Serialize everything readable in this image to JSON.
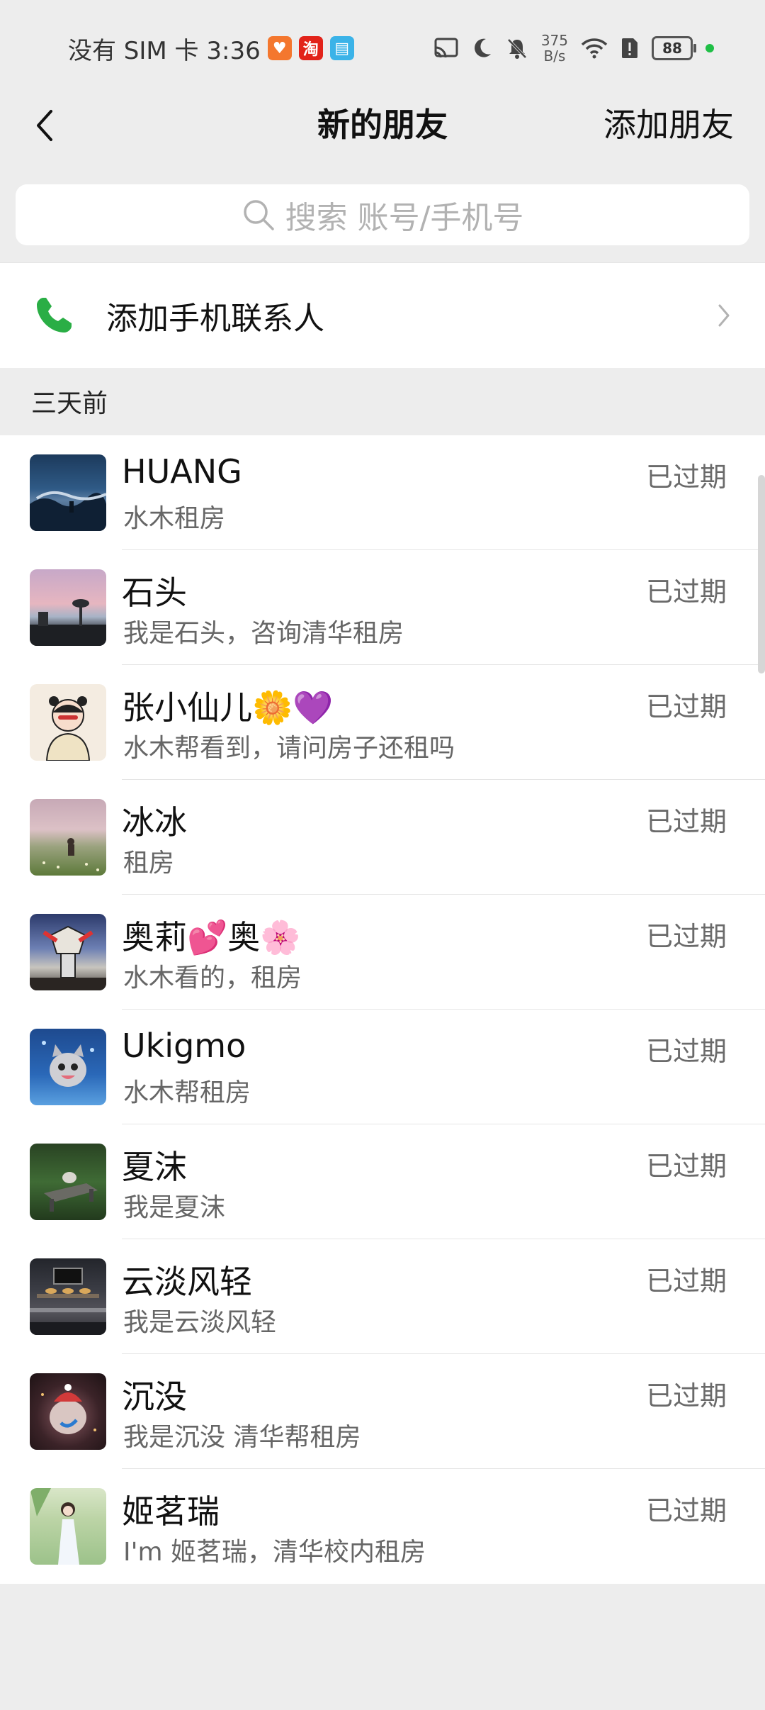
{
  "status_bar": {
    "carrier_time": "没有 SIM 卡 3:36",
    "app_icons": [
      {
        "name": "orange-app-icon",
        "glyph": "♥",
        "color": "#f4772e"
      },
      {
        "name": "taobao-app-icon",
        "glyph": "淘",
        "color": "#e2231a"
      },
      {
        "name": "reader-app-icon",
        "glyph": "▤",
        "color": "#3bb3e8"
      }
    ],
    "net_speed_value": "375",
    "net_speed_unit": "B/s",
    "battery": "88"
  },
  "nav": {
    "title": "新的朋友",
    "action": "添加朋友"
  },
  "search": {
    "placeholder": "搜索 账号/手机号"
  },
  "add_phone": {
    "label": "添加手机联系人"
  },
  "section": {
    "title": "三天前"
  },
  "friends": [
    {
      "name": "HUANG",
      "message": "水木租房",
      "status": "已过期"
    },
    {
      "name": "石头",
      "message": "我是石头，咨询清华租房",
      "status": "已过期"
    },
    {
      "name": "张小仙儿🌼💜",
      "message": "水木帮看到，请问房子还租吗",
      "status": "已过期"
    },
    {
      "name": "冰冰",
      "message": "租房",
      "status": "已过期"
    },
    {
      "name": "奥莉💕奥🌸",
      "message": "水木看的，租房",
      "status": "已过期"
    },
    {
      "name": "Ukigmo",
      "message": "水木帮租房",
      "status": "已过期"
    },
    {
      "name": "夏沫",
      "message": "我是夏沫",
      "status": "已过期"
    },
    {
      "name": "云淡风轻",
      "message": "我是云淡风轻",
      "status": "已过期"
    },
    {
      "name": "沉没",
      "message": "我是沉没 清华帮租房",
      "status": "已过期"
    },
    {
      "name": "姬茗瑞",
      "message": "I'm 姬茗瑞，清华校内租房",
      "status": "已过期"
    }
  ],
  "colors": {
    "background": "#ededed",
    "phone_icon": "#2aae45",
    "status_text": "#6a6a6a"
  }
}
